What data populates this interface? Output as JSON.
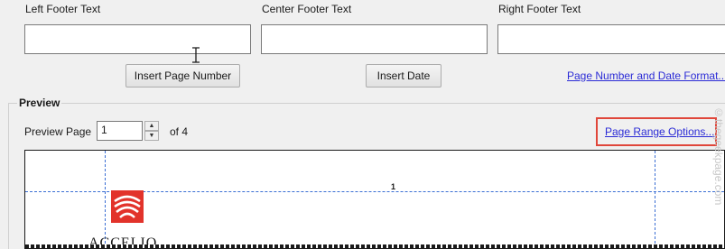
{
  "footer": {
    "left_label": "Left Footer Text",
    "center_label": "Center Footer Text",
    "right_label": "Right Footer Text",
    "left_value": "",
    "center_value": "",
    "right_value": "",
    "insert_page_number_label": "Insert Page Number",
    "insert_date_label": "Insert Date",
    "format_link": "Page Number and Date Format..."
  },
  "preview": {
    "group_title": "Preview",
    "page_label": "Preview Page",
    "page_value": "1",
    "of_label": "of 4",
    "range_link": "Page Range Options...",
    "page_number_text": "1",
    "logo_text": "ACCELIO"
  },
  "watermark": "©thegeekpage.com"
}
